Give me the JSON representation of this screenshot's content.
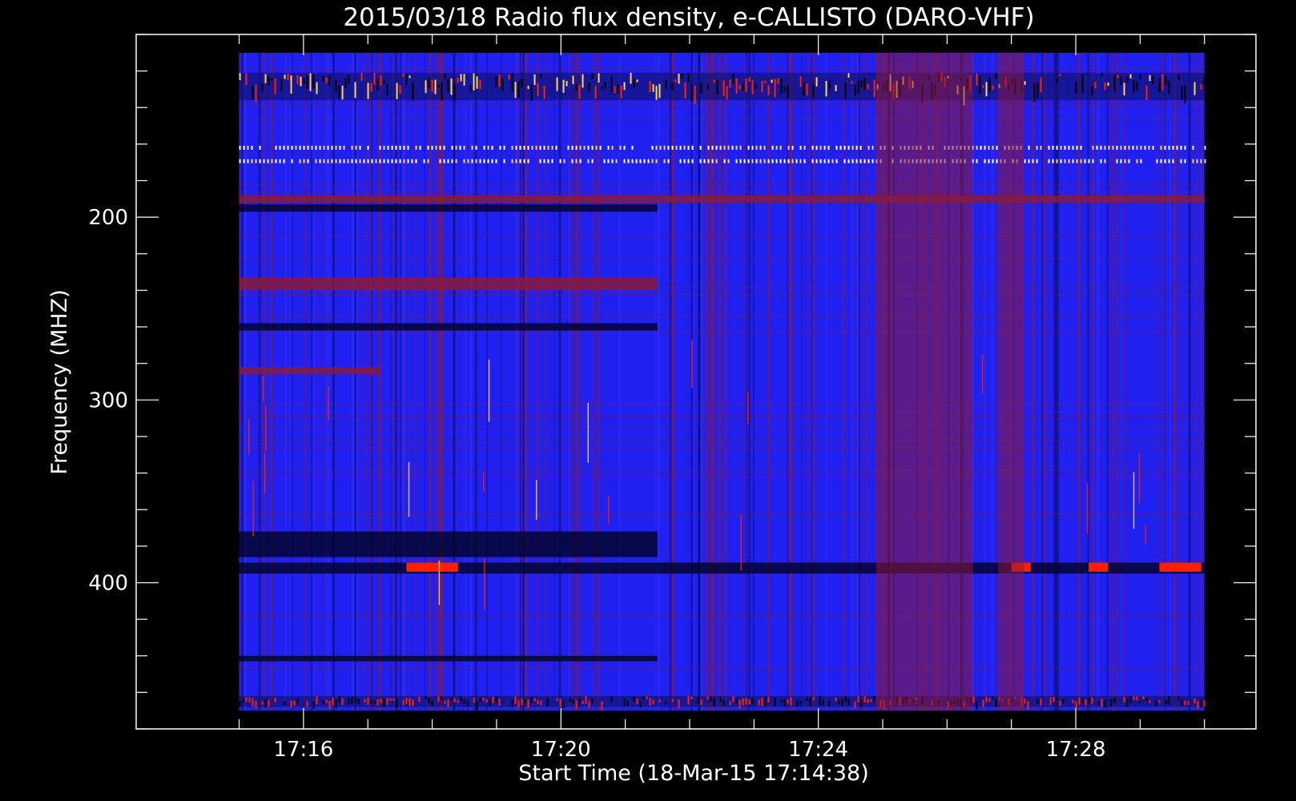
{
  "chart_data": {
    "type": "heatmap",
    "title": "2015/03/18  Radio flux density, e-CALLISTO (DARO-VHF)",
    "xlabel": "Start Time (18-Mar-15 17:14:38)",
    "ylabel": "Frequency (MHZ)",
    "x_ticks": [
      "17:16",
      "17:20",
      "17:24",
      "17:28"
    ],
    "x_tick_minutes": [
      16,
      20,
      24,
      28
    ],
    "x_minor_step_min": 1,
    "x_data_range_min": [
      15,
      30
    ],
    "x_axis_range_min": [
      13.4,
      30.8
    ],
    "y_ticks": [
      200,
      300,
      400
    ],
    "y_minor_step_mhz": 20,
    "y_data_range_mhz": [
      110,
      470
    ],
    "y_axis_range_mhz": [
      100,
      480
    ],
    "y_inverted": true,
    "colors": {
      "background": "#000000",
      "base": "#2020f0",
      "enhanced": "#8a1a3a",
      "burst": "#ff2000",
      "hot": "#ffd060",
      "dark": "#050530"
    },
    "features": [
      {
        "kind": "rfi-band",
        "f_mhz": [
          121,
          136
        ],
        "t_min": [
          15,
          30
        ],
        "level": "hot"
      },
      {
        "kind": "rfi-comb",
        "f_mhz": [
          160,
          170
        ],
        "t_min": [
          15,
          30
        ],
        "level": "white"
      },
      {
        "kind": "band",
        "f_mhz": [
          188,
          192
        ],
        "t_min": [
          15,
          30
        ],
        "level": "enhanced"
      },
      {
        "kind": "band",
        "f_mhz": [
          193,
          197
        ],
        "t_min": [
          15,
          21.5
        ],
        "level": "dark"
      },
      {
        "kind": "band",
        "f_mhz": [
          233,
          240
        ],
        "t_min": [
          15,
          21.5
        ],
        "level": "enhanced"
      },
      {
        "kind": "band",
        "f_mhz": [
          258,
          262
        ],
        "t_min": [
          15,
          21.5
        ],
        "level": "dark"
      },
      {
        "kind": "band",
        "f_mhz": [
          282,
          286
        ],
        "t_min": [
          15,
          17.2
        ],
        "level": "enhanced"
      },
      {
        "kind": "band",
        "f_mhz": [
          372,
          386
        ],
        "t_min": [
          15,
          21.5
        ],
        "level": "dark"
      },
      {
        "kind": "band",
        "f_mhz": [
          389,
          395
        ],
        "t_min": [
          15,
          30
        ],
        "level": "dark"
      },
      {
        "kind": "burst",
        "f_mhz": [
          389,
          394
        ],
        "t_min": [
          27.0,
          27.3
        ],
        "level": "burst"
      },
      {
        "kind": "burst",
        "f_mhz": [
          389,
          394
        ],
        "t_min": [
          28.2,
          28.5
        ],
        "level": "burst"
      },
      {
        "kind": "burst",
        "f_mhz": [
          389,
          394
        ],
        "t_min": [
          29.3,
          29.95
        ],
        "level": "burst"
      },
      {
        "kind": "burst",
        "f_mhz": [
          389,
          394
        ],
        "t_min": [
          17.6,
          18.4
        ],
        "level": "burst"
      },
      {
        "kind": "band",
        "f_mhz": [
          440,
          443
        ],
        "t_min": [
          15,
          21.5
        ],
        "level": "dark"
      },
      {
        "kind": "rfi-band",
        "f_mhz": [
          462,
          468
        ],
        "t_min": [
          15,
          30
        ],
        "level": "burst"
      },
      {
        "kind": "enhanced-column",
        "f_mhz": [
          110,
          470
        ],
        "t_min": [
          24.9,
          26.4
        ],
        "level": "enhanced"
      },
      {
        "kind": "enhanced-column",
        "f_mhz": [
          110,
          470
        ],
        "t_min": [
          26.8,
          27.2
        ],
        "level": "enhanced"
      }
    ]
  }
}
